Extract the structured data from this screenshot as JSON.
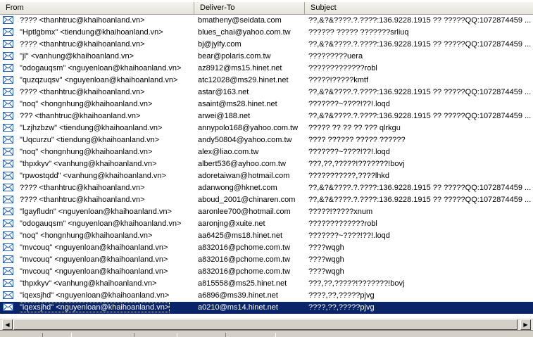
{
  "columns": {
    "from": "From",
    "to": "Deliver-To",
    "subject": "Subject"
  },
  "icons": {
    "message": "envelope-icon",
    "scroll_left": "arrow-left-icon",
    "scroll_right": "arrow-right-icon"
  },
  "colors": {
    "selection": "#0a246a",
    "header": "#ece9d8",
    "envelope": "#2a5fb0"
  },
  "rows": [
    {
      "from": "???? <thanhtruc@khaihoanland.vn>",
      "to": "bmatheny@seidata.com",
      "subject": "??,&?&????.?.????:136.9228.1915 ??  ?????QQ:1072874459  ..."
    },
    {
      "from": "\"Hptlgbmx\" <tiendung@khaihoanland.vn>",
      "to": "blues_chai@yahoo.com.tw",
      "subject": "?????? ????? ???????srliuq"
    },
    {
      "from": "???? <thanhtruc@khaihoanland.vn>",
      "to": "bj@jylfy.com",
      "subject": "??,&?&????.?.????:136.9228.1915 ??  ?????QQ:1072874459  ..."
    },
    {
      "from": "\"jl\" <vanhung@khaihoanland.vn>",
      "to": "bear@polaris.com.tw",
      "subject": "?????????uera"
    },
    {
      "from": "\"odogauqsm\" <nguyenloan@khaihoanland.vn>",
      "to": "az8912@ms15.hinet.net",
      "subject": "?????????????robl"
    },
    {
      "from": "\"quzqzuqsv\" <nguyenloan@khaihoanland.vn>",
      "to": "atc12028@ms29.hinet.net",
      "subject": "?????!?????kmtf"
    },
    {
      "from": "???? <thanhtruc@khaihoanland.vn>",
      "to": "astar@163.net",
      "subject": "??,&?&????.?.????:136.9228.1915 ??  ?????QQ:1072874459  ..."
    },
    {
      "from": "\"noq\" <hongnhung@khaihoanland.vn>",
      "to": "asaint@ms28.hinet.net",
      "subject": "???????~????!??!.loqd"
    },
    {
      "from": "??? <thanhtruc@khaihoanland.vn>",
      "to": "arwei@188.net",
      "subject": "??,&?&????.?.????:136.9228.1915 ??  ?????QQ:1072874459  ..."
    },
    {
      "from": "\"Lzjhzbzw\" <tiendung@khaihoanland.vn>",
      "to": "annypolo168@yahoo.com.tw",
      "subject": "????? ?? ?? ?? ??? qlrkgu"
    },
    {
      "from": "\"Uqcurzu\" <tiendung@khaihoanland.vn>",
      "to": "andy50804@yahoo.com.tw",
      "subject": "???? ?????? ????? ??????"
    },
    {
      "from": "\"noq\" <hongnhung@khaihoanland.vn>",
      "to": "alex@liao.com.tw",
      "subject": "???????~????!??!.loqd"
    },
    {
      "from": "\"thpxkyv\" <vanhung@khaihoanland.vn>",
      "to": "albert536@ayhoo.com.tw",
      "subject": "???,??,?????!???????!bovj"
    },
    {
      "from": "\"rpwostqdd\" <vanhung@khaihoanland.vn>",
      "to": "adoretaiwan@hotmail.com",
      "subject": "???????????,????lhkd"
    },
    {
      "from": "???? <thanhtruc@khaihoanland.vn>",
      "to": "adanwong@hknet.com",
      "subject": "??,&?&????.?.????:136.9228.1915 ??  ?????QQ:1072874459  ..."
    },
    {
      "from": "???? <thanhtruc@khaihoanland.vn>",
      "to": "aboud_2001@chinaren.com",
      "subject": "??,&?&????.?.????:136.9228.1915 ??  ?????QQ:1072874459  ..."
    },
    {
      "from": "\"lgayfludn\" <nguyenloan@khaihoanland.vn>",
      "to": "aaronlee700@hotmail.com",
      "subject": "?????!?????xnum"
    },
    {
      "from": "\"odogauqsm\" <nguyenloan@khaihoanland.vn>",
      "to": "aaronjng@xuite.net",
      "subject": "?????????????robl"
    },
    {
      "from": "\"noq\" <hongnhung@khaihoanland.vn>",
      "to": "aa6425@ms18.hinet.net",
      "subject": "???????~????!??!.loqd"
    },
    {
      "from": "\"mvcouq\" <nguyenloan@khaihoanland.vn>",
      "to": "a832016@pchome.com.tw",
      "subject": "????wqgh"
    },
    {
      "from": "\"mvcouq\" <nguyenloan@khaihoanland.vn>",
      "to": "a832016@pchome.com.tw",
      "subject": "????wqgh"
    },
    {
      "from": "\"mvcouq\" <nguyenloan@khaihoanland.vn>",
      "to": "a832016@pchome.com.tw",
      "subject": "????wqgh"
    },
    {
      "from": "\"thpxkyv\" <vanhung@khaihoanland.vn>",
      "to": "a815558@ms25.hinet.net",
      "subject": "???,??,?????!???????!bovj"
    },
    {
      "from": "\"iqexsjhd\" <nguyenloan@khaihoanland.vn>",
      "to": "a6896@ms39.hinet.net",
      "subject": "????,??,?????pjvg"
    },
    {
      "from": "\"iqexsjhd\" <nguyenloan@khaihoanland.vn>",
      "to": "a0210@ms14.hinet.net",
      "subject": "????,??,?????pjvg",
      "selected": true
    }
  ]
}
